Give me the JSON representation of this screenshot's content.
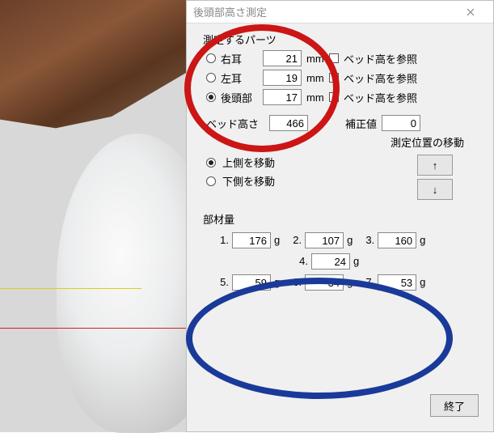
{
  "dialog": {
    "title": "後頭部高さ測定"
  },
  "parts": {
    "section_label": "測定するパーツ",
    "rows": [
      {
        "label": "右耳",
        "value": "21",
        "unit": "mm",
        "ref_label": "ベッド高を参照",
        "selected": false
      },
      {
        "label": "左耳",
        "value": "19",
        "unit": "mm",
        "ref_label": "ベッド高を参照",
        "selected": false
      },
      {
        "label": "後頭部",
        "value": "17",
        "unit": "mm",
        "ref_label": "ベッド高を参照",
        "selected": true
      }
    ]
  },
  "bed": {
    "label": "ベッド高さ",
    "value": "466"
  },
  "correction": {
    "label": "補正値",
    "value": "0"
  },
  "position": {
    "label": "測定位置の移動",
    "upper": "上側を移動",
    "lower": "下側を移動",
    "upper_selected": true,
    "up_arrow": "↑",
    "down_arrow": "↓"
  },
  "materials": {
    "label": "部材量",
    "unit": "g",
    "items": [
      {
        "n": "1.",
        "v": "176"
      },
      {
        "n": "2.",
        "v": "107"
      },
      {
        "n": "3.",
        "v": "160"
      },
      {
        "n": "4.",
        "v": "24"
      },
      {
        "n": "5.",
        "v": "59"
      },
      {
        "n": "6.",
        "v": "34"
      },
      {
        "n": "7.",
        "v": "53"
      }
    ]
  },
  "finish": "終了",
  "annotation": {
    "red_circle": "red-highlight",
    "blue_circle": "blue-highlight"
  }
}
